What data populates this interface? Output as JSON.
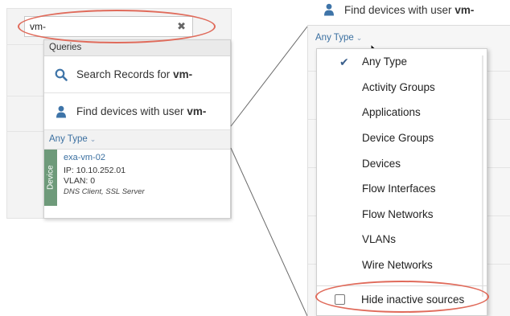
{
  "search": {
    "value": "vm-",
    "clear_glyph": "✖"
  },
  "queries": {
    "header": "Queries",
    "search_records": {
      "prefix": "Search Records for ",
      "term": "vm-",
      "icon": "search-icon"
    },
    "find_devices": {
      "prefix": "Find devices with user ",
      "term": "vm-",
      "icon": "user-icon"
    }
  },
  "type_filter": {
    "label": "Any Type",
    "chevron": "⌄"
  },
  "result": {
    "tag": "Device",
    "name": "exa-vm-02",
    "ip": "IP: 10.10.252.01",
    "vlan": "VLAN: 0",
    "roles": "DNS Client, SSL Server"
  },
  "zoom": {
    "find_devices": {
      "prefix": "Find devices with user ",
      "term": "vm-"
    },
    "type_label": "Any Type",
    "type_chevron": "⌄",
    "menu": {
      "items": [
        {
          "label": "Any Type",
          "checked": true
        },
        {
          "label": "Activity Groups"
        },
        {
          "label": "Applications"
        },
        {
          "label": "Device Groups"
        },
        {
          "label": "Devices"
        },
        {
          "label": "Flow Interfaces"
        },
        {
          "label": "Flow Networks"
        },
        {
          "label": "VLANs"
        },
        {
          "label": "Wire Networks"
        }
      ],
      "check_glyph": "✔",
      "hide_inactive": {
        "label": "Hide inactive sources",
        "checked": false
      }
    }
  },
  "colors": {
    "link_blue": "#3a6fa0",
    "device_tag_green": "#6e9a7a",
    "highlight_red": "#e06b5b",
    "icon_blue": "#3e74a8"
  }
}
